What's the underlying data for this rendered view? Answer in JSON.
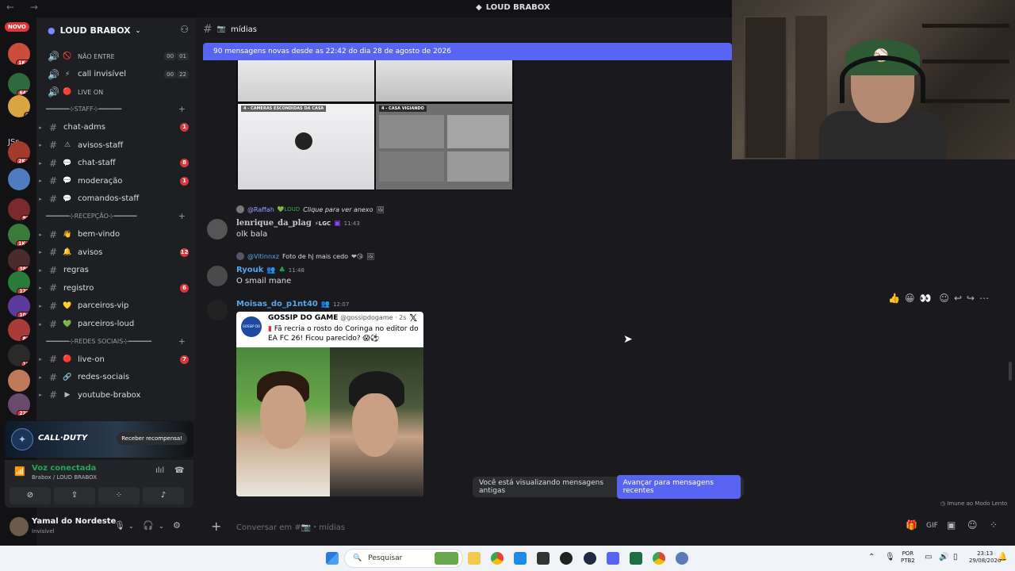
{
  "window": {
    "title": "LOUD BRABOX",
    "nav": "← →"
  },
  "guilds": {
    "novo": "NOVO",
    "js_label": "JSs",
    "items": [
      {
        "badge": "1K+",
        "color": "#c94d3a"
      },
      {
        "badge": "642",
        "color": "#2f6a3c"
      },
      {
        "badge": "6",
        "color": "#d9a441"
      },
      {
        "badge": "2K+",
        "color": "#a13a2a"
      },
      {
        "badge": "",
        "color": "#4e7cbf"
      },
      {
        "badge": "95",
        "color": "#7a2a2a"
      },
      {
        "badge": "1K+",
        "color": "#3a7a3a"
      },
      {
        "badge": "389",
        "color": "#4a2a2a"
      },
      {
        "badge": "128",
        "color": "#2a7a3a"
      },
      {
        "badge": "104",
        "color": "#5a3a9a"
      },
      {
        "badge": "80",
        "color": "#a83a3a"
      },
      {
        "badge": "18",
        "color": "#2a2a2a"
      },
      {
        "badge": "",
        "color": "#bf7a5a"
      },
      {
        "badge": "220",
        "color": "#6a4a6a"
      }
    ]
  },
  "sidebar": {
    "server_name": "LOUD BRABOX",
    "voice": [
      {
        "label": "NÃO ENTRE",
        "c1": "00",
        "c2": "01",
        "emoji": "🚫"
      },
      {
        "label": "call invisível",
        "c1": "00",
        "c2": "22",
        "emoji": "⚡"
      },
      {
        "label": "LIVE ON",
        "emoji": "🔴"
      }
    ],
    "cat_staff": "━━━━━━⊹STAFF⊹━━━━━━",
    "staff": [
      {
        "label": "chat-adms",
        "count": "1",
        "emoji": ""
      },
      {
        "label": "avisos-staff",
        "count": "",
        "emoji": "⚠"
      },
      {
        "label": "chat-staff",
        "count": "8",
        "emoji": "💬"
      },
      {
        "label": "moderação",
        "count": "1",
        "emoji": "💬"
      },
      {
        "label": "comandos-staff",
        "count": "",
        "emoji": "💬"
      }
    ],
    "cat_recepcao": "━━━━━━⊹RECEPÇÃO⊹━━━━━━",
    "recepcao": [
      {
        "label": "bem-vindo",
        "count": "",
        "emoji": "👋"
      },
      {
        "label": "avisos",
        "count": "12",
        "emoji": "🔔"
      },
      {
        "label": "regras",
        "count": "",
        "emoji": ""
      },
      {
        "label": "registro",
        "count": "6",
        "emoji": ""
      },
      {
        "label": "parceiros-vip",
        "count": "",
        "emoji": "💛"
      },
      {
        "label": "parceiros-loud",
        "count": "",
        "emoji": "💚"
      }
    ],
    "cat_redes": "━━━━━━⊹REDES SOCIAIS⊹━━━━━━",
    "redes": [
      {
        "label": "live-on",
        "count": "7",
        "emoji": "🔴"
      },
      {
        "label": "redes-sociais",
        "count": "",
        "emoji": "🔗"
      },
      {
        "label": "youtube-brabox",
        "count": "",
        "emoji": "▶"
      }
    ]
  },
  "promo": {
    "name": "CALL·DUTY",
    "button": "Receber recompensa!"
  },
  "voice_panel": {
    "status": "Voz conectada",
    "location": "Brabox / LOUD BRABOX"
  },
  "user": {
    "name": "Yamal do Nordeste",
    "status": "Invisível"
  },
  "channel": {
    "name": "mídias",
    "new_messages": "90 mensagens novas desde as 22:42 do dia 28 de agosto de 2026"
  },
  "image_grid": {
    "captions": [
      "4 - CAMERAS ESCONDIDAS DA CASA",
      "4 - CASA VIGIANDO"
    ]
  },
  "messages": [
    {
      "reply_user": "@Raffah",
      "reply_tag": "LOUD",
      "reply_text": "Clique para ver anexo",
      "author": "lenrique_da_plag",
      "author_tag": "LGC",
      "time": "11:43",
      "text": "olk bala",
      "author_color": "#dbdee1"
    },
    {
      "reply_user": "@Vitinnxz",
      "reply_text": "Foto de hj mais cedo",
      "author": "Ryouk",
      "time": "11:48",
      "text": "O smail mane",
      "author_color": "#5ba4e6"
    },
    {
      "author": "Moisas_do_p1nt40",
      "time": "12:07",
      "author_color": "#5ba4e6"
    }
  ],
  "embed": {
    "source": "GOSSIP DO GAME",
    "handle": "@gossipdogame · 2s",
    "logo_text": "GOSSIP DO GAME",
    "body": "Fã recria o rosto do Coringa no editor do EA FC 26! Ficou parecido? 😱⚽"
  },
  "banner": {
    "text": "Você está visualizando mensagens antigas",
    "jump": "Avançar para mensagens recentes"
  },
  "slowmode": "Imune ao Modo Lento",
  "composer": {
    "placeholder": "Conversar em #📷・mídias"
  },
  "taskbar": {
    "search": "Pesquisar",
    "lang1": "POR",
    "lang2": "PTB2",
    "time": "23:13",
    "date": "29/08/2026"
  }
}
